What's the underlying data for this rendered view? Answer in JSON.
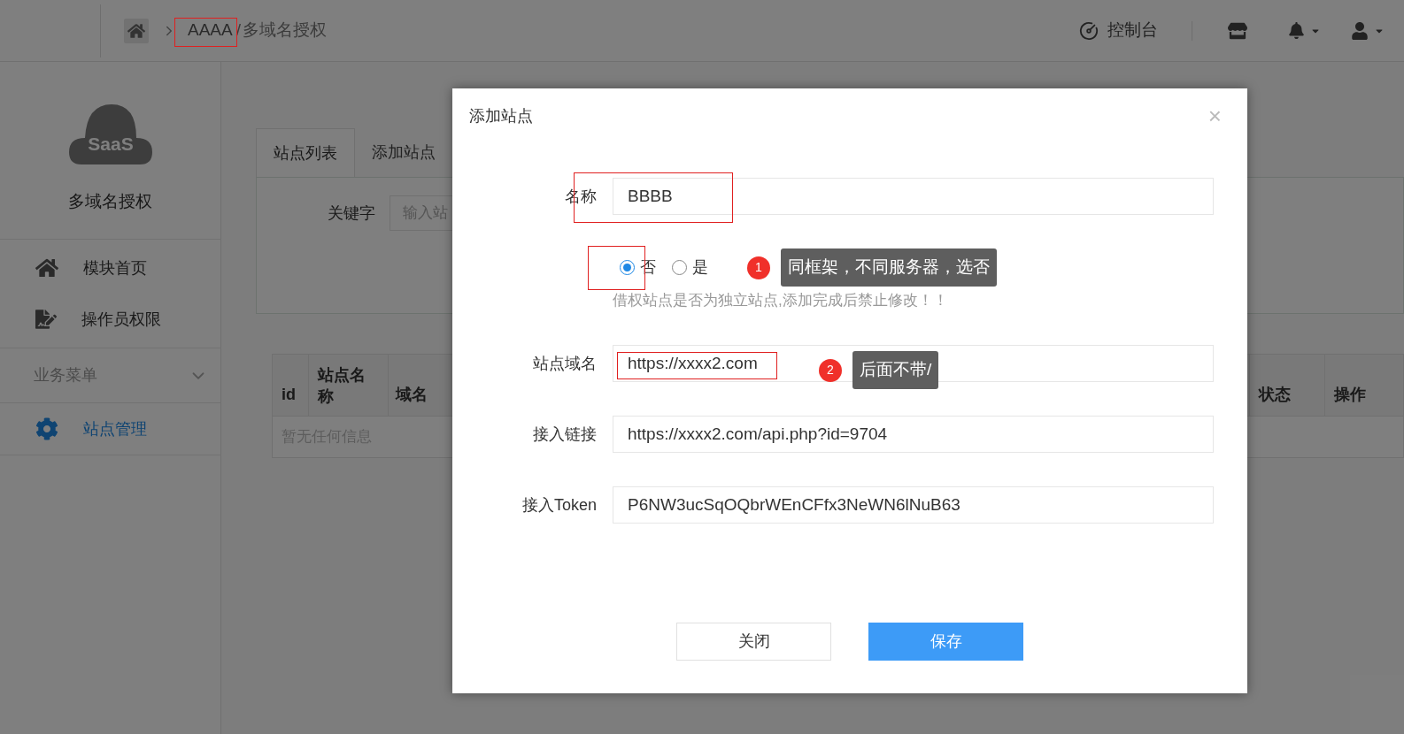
{
  "topbar": {
    "breadcrumb": [
      {
        "label": "AAAA"
      },
      {
        "label": "多域名授权"
      }
    ],
    "separator": "/",
    "actions": [
      {
        "label": "控制台"
      }
    ]
  },
  "sidebar": {
    "logo_text": "SaaS",
    "title": "多域名授权",
    "items": [
      {
        "label": "模块首页",
        "selected": false,
        "kind": "home"
      },
      {
        "label": "操作员权限",
        "selected": false,
        "kind": "file"
      }
    ],
    "section": {
      "label": "业务菜单",
      "expanded": true,
      "items": [
        {
          "label": "站点管理",
          "selected": true,
          "kind": "gear"
        }
      ]
    }
  },
  "tabs": [
    {
      "label": "站点列表",
      "selected": true
    },
    {
      "label": "添加站点",
      "selected": false
    }
  ],
  "search": {
    "label": "关键字",
    "placeholder": "输入站"
  },
  "table": {
    "columns": [
      "id",
      "站点名称",
      "域名",
      "状态",
      "操作"
    ],
    "empty_text": "暂无任何信息"
  },
  "dialog": {
    "title": "添加站点",
    "close": "×",
    "name_field": {
      "label": "名称",
      "value": "BBBB"
    },
    "independent": {
      "options": [
        {
          "label": "否",
          "selected": true
        },
        {
          "label": "是",
          "selected": false
        }
      ],
      "hint": "借权站点是否为独立站点,添加完成后禁止修改！！",
      "callout": {
        "number": "1",
        "text": "同框架，不同服务器，选否"
      }
    },
    "fields": [
      {
        "label": "站点域名",
        "value": "https://xxxx2.com",
        "callout": {
          "number": "2",
          "text": "后面不带/"
        }
      },
      {
        "label": "接入链接",
        "value": "https://xxxx2.com/api.php?id=9704"
      },
      {
        "label": "接入Token",
        "value": "P6NW3ucSqOQbrWEnCFfx3NeWN6lNuB63"
      }
    ],
    "buttons": [
      {
        "label": "关闭",
        "kind": "default"
      },
      {
        "label": "保存",
        "kind": "primary"
      }
    ]
  }
}
